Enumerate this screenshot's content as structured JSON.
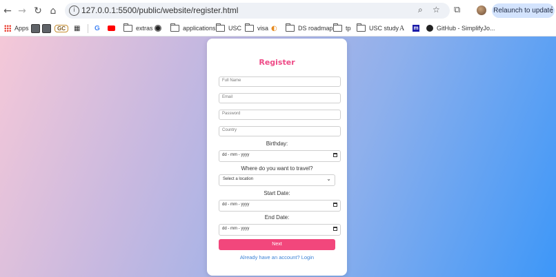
{
  "browser": {
    "url": "127.0.0.1:5500/public/website/register.html",
    "relaunch_label": "Relaunch to update",
    "bookmarks": [
      {
        "label": "Apps",
        "icon": "apps-grid-icon"
      },
      {
        "label": "",
        "icon": "square-app-icon"
      },
      {
        "label": "",
        "icon": "square-app-icon"
      },
      {
        "label": "GC",
        "icon": "gc-icon"
      },
      {
        "label": "",
        "icon": "qr-icon"
      },
      {
        "label": "",
        "icon": "google-icon"
      },
      {
        "label": "",
        "icon": "youtube-icon"
      },
      {
        "label": "extras",
        "icon": "folder-icon"
      },
      {
        "label": "",
        "icon": "record-icon"
      },
      {
        "label": "applications",
        "icon": "folder-icon"
      },
      {
        "label": "USC",
        "icon": "folder-icon"
      },
      {
        "label": "visa",
        "icon": "folder-icon"
      },
      {
        "label": "",
        "icon": "leaf-icon"
      },
      {
        "label": "DS roadmap",
        "icon": "folder-icon"
      },
      {
        "label": "tp",
        "icon": "folder-icon"
      },
      {
        "label": "USC study",
        "icon": "folder-icon"
      },
      {
        "label": "",
        "icon": "font-a-icon"
      },
      {
        "label": "",
        "icon": "m-icon"
      },
      {
        "label": "GitHub - SimplifyJo...",
        "icon": "github-icon"
      }
    ]
  },
  "form": {
    "title": "Register",
    "full_name_placeholder": "Full Name",
    "email_placeholder": "Email",
    "password_placeholder": "Password",
    "country_placeholder": "Country",
    "birthday_label": "Birthday:",
    "date_placeholder": "dd - mm - yyyy",
    "travel_label": "Where do you want to travel?",
    "location_select": "Select a location",
    "start_label": "Start Date:",
    "end_label": "End Date:",
    "next_label": "Next",
    "login_link": "Already have an account? Login"
  },
  "colors": {
    "accent": "#f2477c",
    "title": "#ee4a86",
    "link": "#3b82d6"
  }
}
